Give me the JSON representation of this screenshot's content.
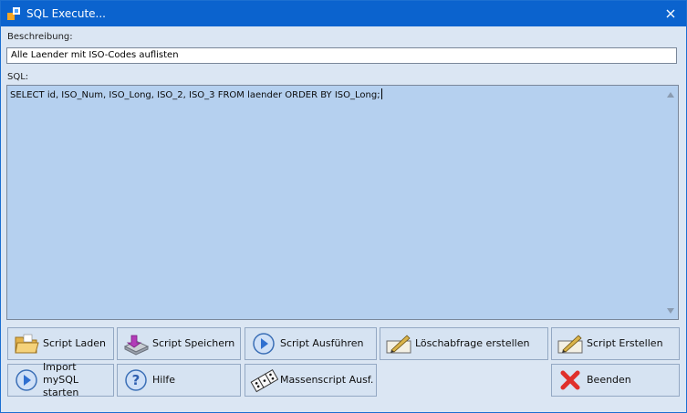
{
  "window": {
    "title": "SQL Execute..."
  },
  "form": {
    "beschreibung_label": "Beschreibung:",
    "beschreibung_value": "Alle Laender mit ISO-Codes auflisten",
    "sql_label": "SQL:",
    "sql_value": "SELECT id, ISO_Num, ISO_Long, ISO_2, ISO_3 FROM laender ORDER BY ISO_Long;"
  },
  "buttons": {
    "script_laden": "Script Laden",
    "script_speichern": "Script Speichern",
    "script_ausfuehren": "Script Ausführen",
    "loeschabfrage": "Löschabfrage erstellen",
    "script_erstellen": "Script Erstellen",
    "import_mysql_line1": "Import mySQL",
    "import_mysql_line2": "starten",
    "hilfe": "Hilfe",
    "massenscript": "Massenscript Ausf.",
    "beenden": "Beenden"
  },
  "icons": {
    "app": "app-icon",
    "close": "close-icon",
    "folder": "folder-icon",
    "save": "save-disk-icon",
    "play": "play-icon",
    "pen": "pen-edit-icon",
    "help": "help-icon",
    "dominos": "domino-icon",
    "cancel": "cancel-x-icon"
  },
  "colors": {
    "titlebar": "#0b63ce",
    "client": "#dbe6f3",
    "sql_background": "#b5d0ef",
    "button": "#d6e3f2",
    "cancel": "#e0302b"
  }
}
